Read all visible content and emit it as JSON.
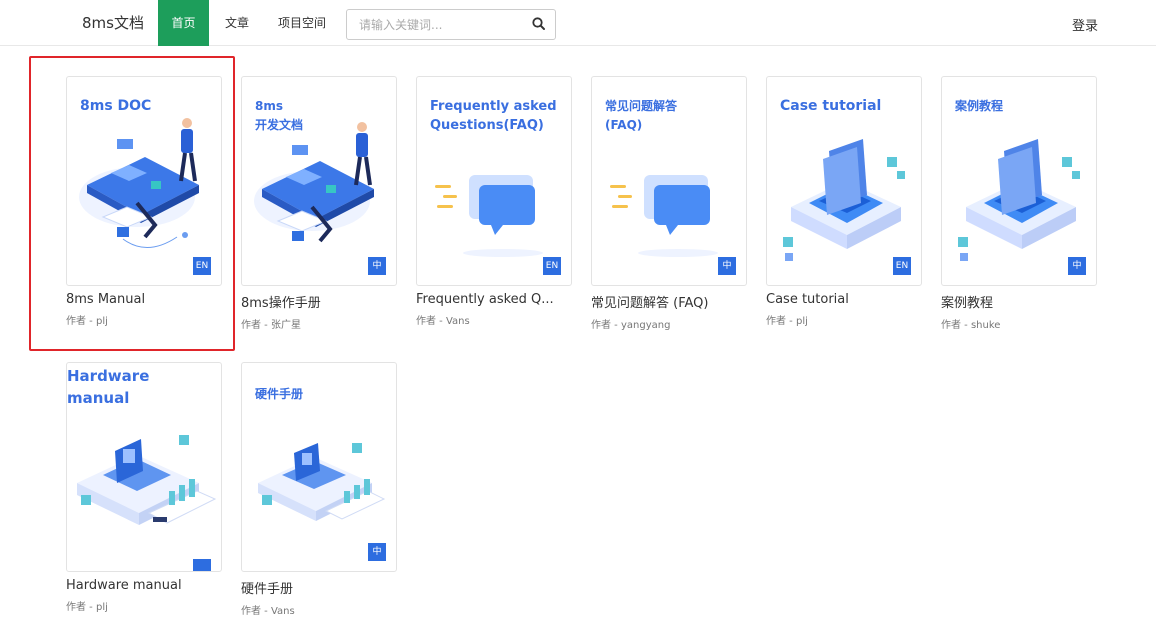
{
  "nav": {
    "brand": "8ms文档",
    "links": [
      "首页",
      "文章",
      "项目空间"
    ],
    "search_placeholder": "请输入关键词...",
    "login": "登录"
  },
  "books": [
    {
      "cover_title": "8ms DOC",
      "title": "8ms Manual",
      "author": "作者 - plj",
      "lang": "EN",
      "art": "desk"
    },
    {
      "cover_title": "8ms\n开发文档",
      "title": "8ms操作手册",
      "author": "作者 - 张广星",
      "lang": "中",
      "art": "desk"
    },
    {
      "cover_title": "Frequently asked Questions(FAQ)",
      "title": "Frequently asked Q...",
      "author": "作者 - Vans",
      "lang": "EN",
      "art": "chat"
    },
    {
      "cover_title": "常见问题解答\n(FAQ)",
      "title": "常见问题解答 (FAQ)",
      "author": "作者 - yangyang",
      "lang": "中",
      "art": "chat"
    },
    {
      "cover_title": "Case tutorial",
      "title": "Case tutorial",
      "author": "作者 - plj",
      "lang": "EN",
      "art": "doc"
    },
    {
      "cover_title": "案例教程",
      "title": "案例教程",
      "author": "作者 - shuke",
      "lang": "中",
      "art": "doc"
    },
    {
      "cover_title": "Hardware\nmanual",
      "title": "Hardware manual",
      "author": "作者 - plj",
      "lang": "",
      "art": "hw"
    },
    {
      "cover_title": "硬件手册",
      "title": "硬件手册",
      "author": "作者 - Vans",
      "lang": "中",
      "art": "hw"
    }
  ],
  "colors": {
    "accent": "#1d9e5b",
    "cover_blue": "#3a6fe0",
    "badge": "#2d6de0",
    "highlight": "#e0252a"
  }
}
